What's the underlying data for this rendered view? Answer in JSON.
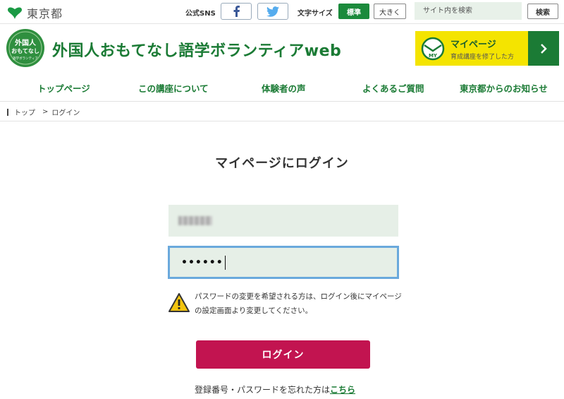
{
  "top_bar": {
    "gov_name": "東京都",
    "sns_label": "公式SNS",
    "text_size_label": "文字サイズ",
    "size_standard": "標準",
    "size_large": "大きく",
    "search_placeholder": "サイト内を検索",
    "search_button": "検索"
  },
  "header": {
    "logo_text": "外国人おもてなし語学ボランティア",
    "site_title": "外国人おもてなし語学ボランティアweb",
    "mypage_title": "マイページ",
    "mypage_sub": "育成講座を修了した方",
    "mypage_badge": "MY"
  },
  "nav": {
    "items": [
      "トップページ",
      "この講座について",
      "体験者の声",
      "よくあるご質問",
      "東京都からのお知らせ"
    ]
  },
  "breadcrumb": {
    "home": "トップ",
    "separator": ">",
    "current": "ログイン"
  },
  "login": {
    "title": "マイページにログイン",
    "password_value": "••••••",
    "notice": "パスワードの変更を希望される方は、ログイン後にマイページの設定画面より変更してください。",
    "button": "ログイン",
    "forgot_text": "登録番号・パスワードを忘れた方は",
    "forgot_link": "こちら"
  },
  "colors": {
    "brand_green": "#1b7b35",
    "login_button": "#c21450",
    "mypage_yellow": "#f4e400",
    "input_bg": "#e6efe7",
    "focus_border": "#6aa9dc"
  }
}
